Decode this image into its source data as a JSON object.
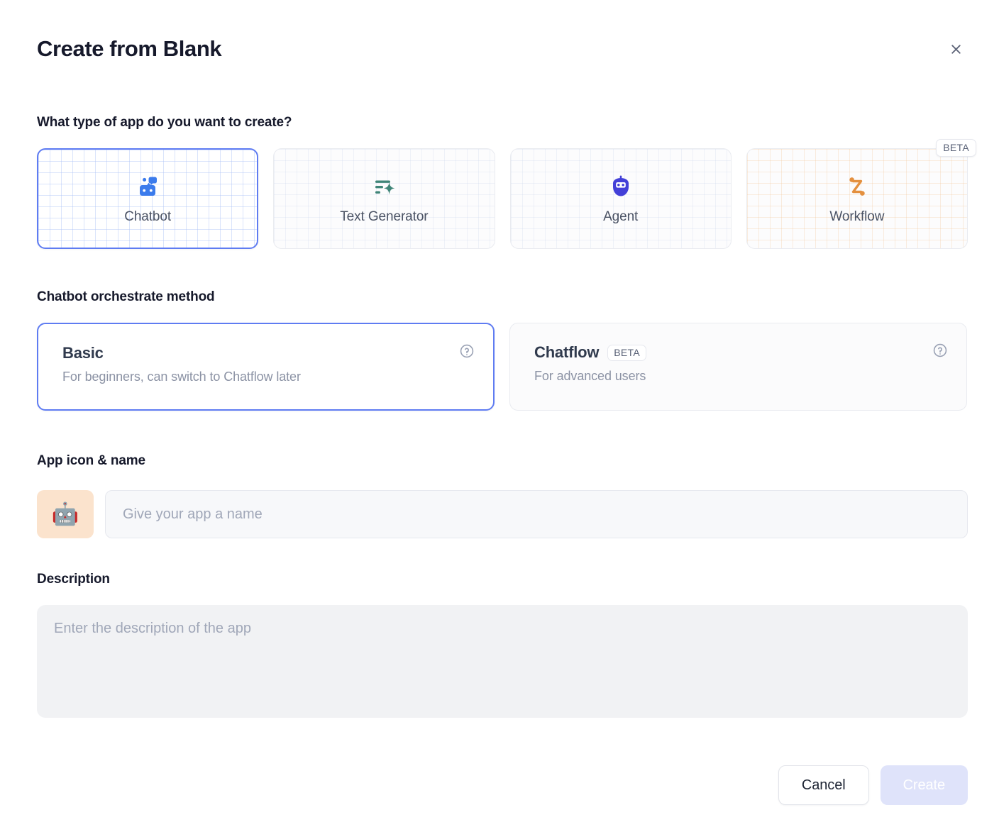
{
  "header": {
    "title": "Create from Blank",
    "close_icon": "close-icon"
  },
  "app_type": {
    "question": "What type of app do you want to create?",
    "options": [
      {
        "label": "Chatbot",
        "icon": "chatbot-icon",
        "selected": true,
        "badge": ""
      },
      {
        "label": "Text Generator",
        "icon": "text-generator-icon",
        "selected": false,
        "badge": ""
      },
      {
        "label": "Agent",
        "icon": "agent-icon",
        "selected": false,
        "badge": ""
      },
      {
        "label": "Workflow",
        "icon": "workflow-icon",
        "selected": false,
        "badge": "BETA"
      }
    ]
  },
  "orchestrate": {
    "label": "Chatbot orchestrate method",
    "options": [
      {
        "title": "Basic",
        "badge": "",
        "subtitle": "For beginners, can switch to Chatflow later",
        "selected": true,
        "help_icon": "help-circle-icon"
      },
      {
        "title": "Chatflow",
        "badge": "BETA",
        "subtitle": "For advanced users",
        "selected": false,
        "help_icon": "help-circle-icon"
      }
    ]
  },
  "app_identity": {
    "label": "App icon & name",
    "icon_emoji": "🤖",
    "icon_background": "#fbe3cd",
    "name_value": "",
    "name_placeholder": "Give your app a name"
  },
  "description": {
    "label": "Description",
    "value": "",
    "placeholder": "Enter the description of the app"
  },
  "footer": {
    "cancel_label": "Cancel",
    "create_label": "Create",
    "create_disabled": true
  },
  "colors": {
    "accent_blue": "#5f7cf2",
    "chatbot_icon": "#3b7bec",
    "text_generator_icon": "#3f8578",
    "agent_icon": "#4340d8",
    "workflow_icon": "#e4903f",
    "title": "#16192b",
    "muted_text": "#8b92a4",
    "create_disabled_bg": "#dfe3fa"
  }
}
